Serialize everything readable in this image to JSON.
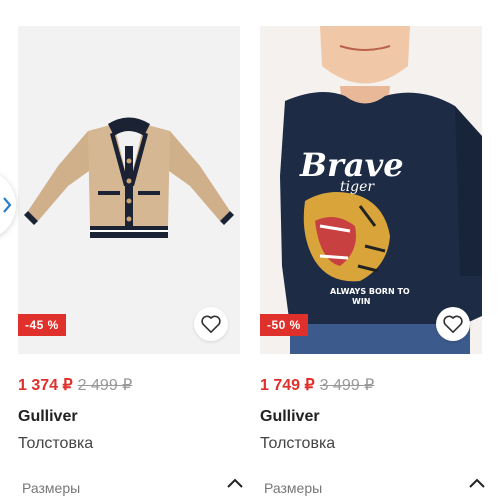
{
  "colors": {
    "sale": "#e0302b",
    "discount_bg": "#e0302b",
    "accent_arrow": "#2a7ec6"
  },
  "products": [
    {
      "discount": "-45 %",
      "price_new": "1 374 ₽",
      "price_old": "2 499 ₽",
      "brand": "Gulliver",
      "type": "Толстовка",
      "sizes_label": "Размеры",
      "image": "beige-knit-cardigan"
    },
    {
      "discount": "-50 %",
      "price_new": "1 749 ₽",
      "price_old": "3 499 ₽",
      "brand": "Gulliver",
      "type": "Толстовка",
      "sizes_label": "Размеры",
      "image": "navy-tiger-sweatshirt",
      "image_text": {
        "brave": "Brave",
        "tiger": "tiger",
        "slogan1": "ALWAYS BORN TO",
        "slogan2": "WIN"
      }
    }
  ],
  "icons": {
    "favorite": "heart-icon",
    "collapse": "chevron-up-icon",
    "prev": "chevron-left-icon"
  }
}
